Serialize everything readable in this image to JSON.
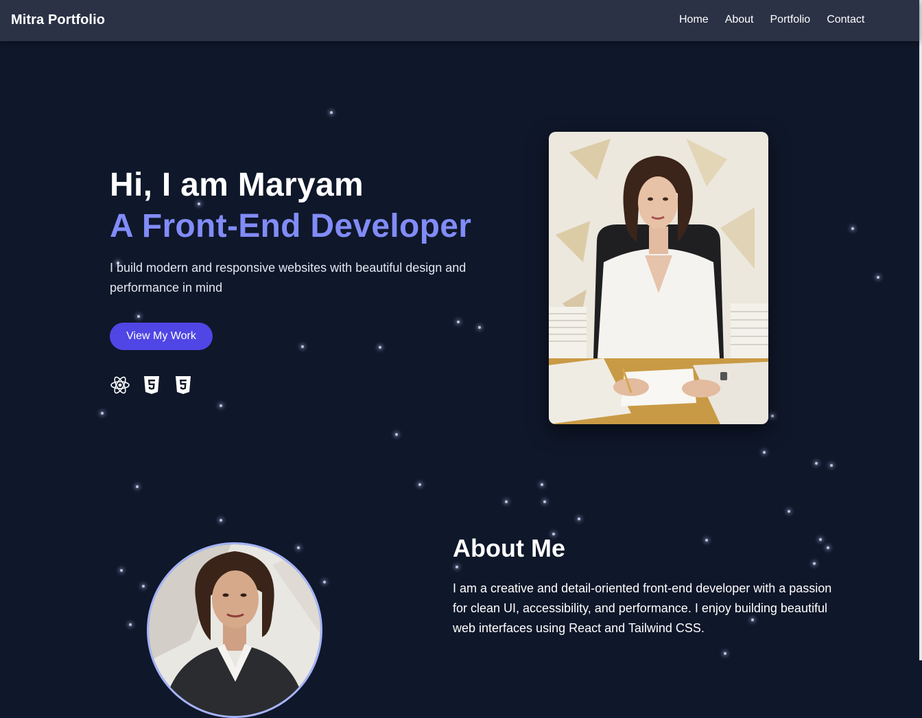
{
  "nav": {
    "brand": "Mitra Portfolio",
    "links": [
      "Home",
      "About",
      "Portfolio",
      "Contact"
    ]
  },
  "hero": {
    "greeting": "Hi, I am Maryam",
    "role": "A Front-End Developer",
    "description": "I build modern and responsive websites with beautiful design and performance in mind",
    "cta_label": "View My Work",
    "tech_icons": [
      "react-icon",
      "html5-icon",
      "css3-icon"
    ],
    "portrait": "portrait-illustration"
  },
  "about": {
    "title": "About Me",
    "description": "I am a creative and detail-oriented front-end developer with a passion for clean UI, accessibility, and performance. I enjoy building beautiful web interfaces using React and Tailwind CSS.",
    "avatar": "profile-avatar"
  },
  "colors": {
    "background": "#0f172a",
    "navbar": "#2b3246",
    "accent": "#818cf8",
    "button": "#4f46e5",
    "avatar_border": "#a5b4fc"
  }
}
